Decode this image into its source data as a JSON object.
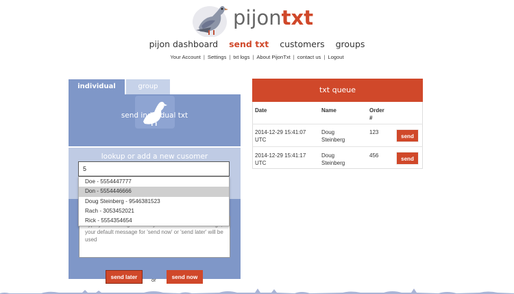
{
  "header": {
    "logo_text_plain": "pijon",
    "logo_text_accent": "txt",
    "logo_icon": "pigeon-icon"
  },
  "nav": {
    "items": [
      {
        "label": "pijon dashboard",
        "active": false
      },
      {
        "label": "send txt",
        "active": true
      },
      {
        "label": "customers",
        "active": false
      },
      {
        "label": "groups",
        "active": false
      }
    ]
  },
  "subnav": {
    "items": [
      "Your Account",
      "Settings",
      "txt logs",
      "About PijonTxt",
      "contact us",
      "Logout"
    ],
    "separator": "|"
  },
  "tabs": {
    "individual": "individual",
    "group": "group"
  },
  "send_panel": {
    "title": "send individual txt",
    "icon": "pigeon-icon",
    "lookup_title": "lookup or add a new cusomer",
    "lookup_value": "5",
    "suggestions": [
      {
        "label": "Doe - 5554447777",
        "highlighted": false
      },
      {
        "label": "Don - 5554446666",
        "highlighted": true
      },
      {
        "label": "Doug Steinberg - 9546381523",
        "highlighted": false
      },
      {
        "label": "Rach - 3053452021",
        "highlighted": false
      },
      {
        "label": "Rick - 5554354654",
        "highlighted": false
      }
    ],
    "message_placeholder": "Type your message here. If you do not enter a message, your default message for 'send now' or 'send later' will be used",
    "send_later_label": "send later",
    "or_label": "or",
    "send_now_label": "send now"
  },
  "queue": {
    "title": "txt queue",
    "columns": [
      "Date",
      "Name",
      "Order #"
    ],
    "rows": [
      {
        "date": "2014-12-29 15:41:07 UTC",
        "name": "Doug Steinberg",
        "order": "123",
        "action": "send"
      },
      {
        "date": "2014-12-29 15:41:17 UTC",
        "name": "Doug Steinberg",
        "order": "456",
        "action": "send"
      }
    ]
  },
  "colors": {
    "accent": "#d0482a",
    "panel_blue": "#7f97c8",
    "panel_light_blue": "#bfcbe4",
    "highlight_gray": "#cfcfcf"
  }
}
